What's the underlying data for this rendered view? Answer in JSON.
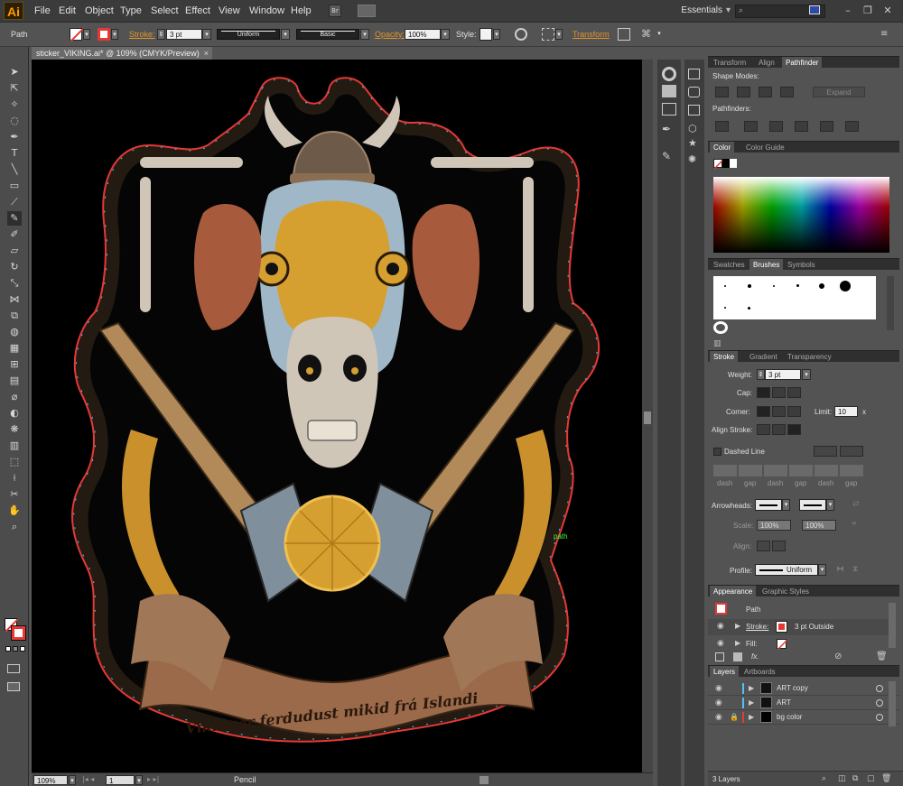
{
  "app": {
    "logo": "Ai",
    "workspace": "Essentials",
    "workspace_arrow": "▾",
    "br_label": "Br"
  },
  "menu": [
    "File",
    "Edit",
    "Object",
    "Type",
    "Select",
    "Effect",
    "View",
    "Window",
    "Help"
  ],
  "control": {
    "selection": "Path",
    "stroke_label": "Stroke:",
    "stroke_weight": "3 pt",
    "profile": "Uniform",
    "brush": "Basic",
    "opacity_label": "Opacity:",
    "opacity": "100%",
    "style_label": "Style:",
    "transform_label": "Transform"
  },
  "document": {
    "tab": "sticker_VIKING.ai* @ 109% (CMYK/Preview)",
    "close": "×",
    "path_hint": "path",
    "banner_text": "Vikingar ferdudust mikid frá Islandi"
  },
  "status": {
    "zoom": "109%",
    "artboard": "1",
    "tool": "Pencil"
  },
  "panels": {
    "pathfinder": {
      "tabs": [
        "Transform",
        "Align",
        "Pathfinder"
      ],
      "shape_modes": "Shape Modes:",
      "expand": "Expand",
      "pathfinders": "Pathfinders:"
    },
    "color": {
      "tabs": [
        "Color",
        "Color Guide"
      ]
    },
    "brushes": {
      "tabs": [
        "Swatches",
        "Brushes",
        "Symbols"
      ]
    },
    "stroke": {
      "tabs": [
        "Stroke",
        "Gradient",
        "Transparency"
      ],
      "weight_label": "Weight:",
      "weight": "3 pt",
      "cap_label": "Cap:",
      "corner_label": "Corner:",
      "limit_label": "Limit:",
      "limit": "10",
      "limit_unit": "x",
      "align_label": "Align Stroke:",
      "dashed": "Dashed Line",
      "dash_labels": [
        "dash",
        "gap",
        "dash",
        "gap",
        "dash",
        "gap"
      ],
      "arrowheads_label": "Arrowheads:",
      "scale_label": "Scale:",
      "scale1": "100%",
      "scale2": "100%",
      "align2_label": "Align:",
      "profile_label": "Profile:",
      "profile": "Uniform"
    },
    "appearance": {
      "tabs": [
        "Appearance",
        "Graphic Styles"
      ],
      "object": "Path",
      "stroke_label": "Stroke:",
      "stroke_value": "3 pt  Outside",
      "fill_label": "Fill:",
      "fx_label": "fx."
    },
    "layers": {
      "tabs": [
        "Layers",
        "Artboards"
      ],
      "items": [
        {
          "name": "ART copy",
          "color": "#4fc3f7"
        },
        {
          "name": "ART",
          "color": "#4fc3f7"
        },
        {
          "name": "bg color",
          "color": "#e53935"
        }
      ],
      "count": "3 Layers"
    }
  },
  "colors": {
    "accent": "#e2942a",
    "stroke_red": "#e53935",
    "selection_blue": "#4fc3f7"
  }
}
